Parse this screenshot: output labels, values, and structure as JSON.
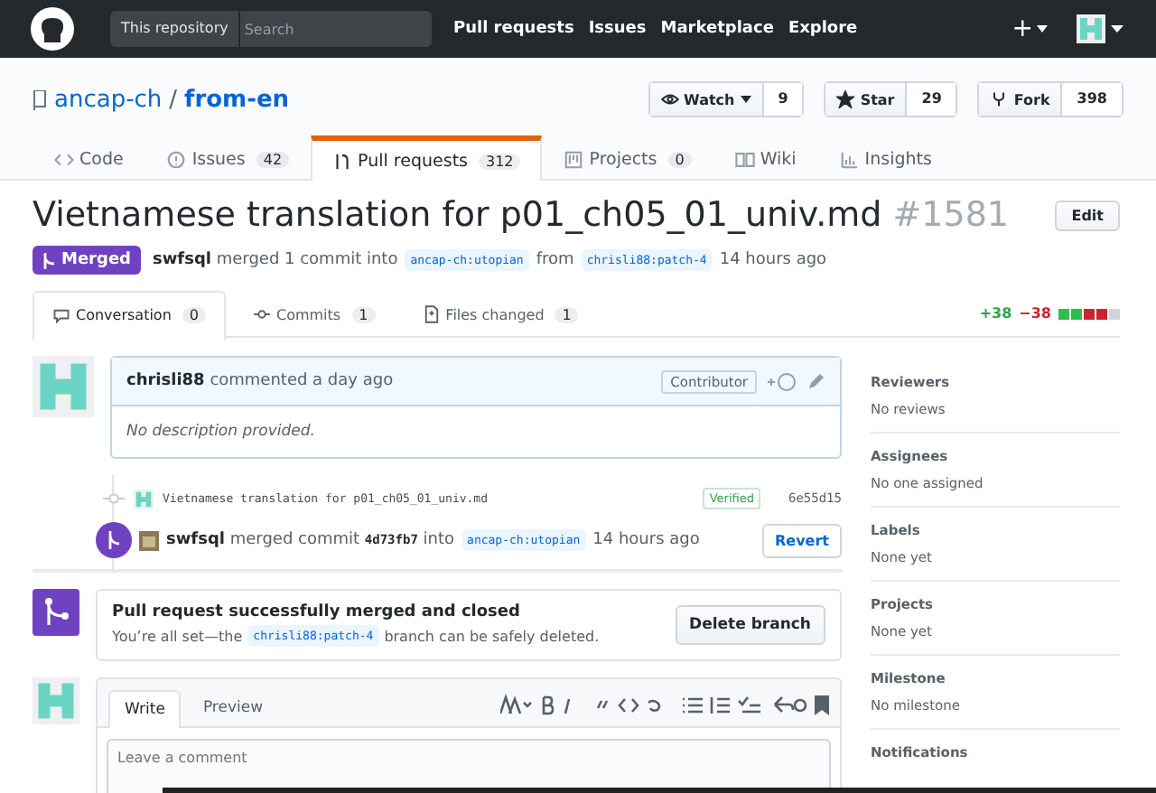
{
  "header": {
    "scope": "This repository",
    "search_placeholder": "Search",
    "nav": [
      "Pull requests",
      "Issues",
      "Marketplace",
      "Explore"
    ],
    "plus": "+"
  },
  "repo": {
    "owner": "ancap-ch",
    "separator": "/",
    "name": "from-en",
    "actions": [
      {
        "label": "Watch",
        "count": "9",
        "kind": "eye"
      },
      {
        "label": "Star",
        "count": "29",
        "kind": "star"
      },
      {
        "label": "Fork",
        "count": "398",
        "kind": "fork"
      }
    ]
  },
  "repo_tabs": [
    {
      "label": "Code",
      "kind": "code",
      "selected": false
    },
    {
      "label": "Issues",
      "count": "42",
      "kind": "issue",
      "selected": false
    },
    {
      "label": "Pull requests",
      "count": "312",
      "kind": "pr",
      "selected": true
    },
    {
      "label": "Projects",
      "count": "0",
      "kind": "project",
      "selected": false
    },
    {
      "label": "Wiki",
      "kind": "wiki",
      "selected": false
    },
    {
      "label": "Insights",
      "kind": "graph",
      "selected": false
    }
  ],
  "pr": {
    "title": "Vietnamese translation for p01_ch05_01_univ.md",
    "number": "#1581",
    "edit": "Edit",
    "state": "Merged",
    "author": "swfsql",
    "summary": "merged 1 commit into",
    "base": "ancap-ch:utopian",
    "from": "from",
    "head": "chrisli88:patch-4",
    "time": "14 hours ago"
  },
  "pr_tabs": [
    {
      "label": "Conversation",
      "count": "0",
      "kind": "comment",
      "selected": true
    },
    {
      "label": "Commits",
      "count": "1",
      "kind": "commit",
      "selected": false
    },
    {
      "label": "Files changed",
      "count": "1",
      "kind": "file",
      "selected": false
    }
  ],
  "diffstat": {
    "added": "+38",
    "removed": "−38",
    "blocks": [
      {
        "kind": "add"
      },
      {
        "kind": "add"
      },
      {
        "kind": "del"
      },
      {
        "kind": "del"
      },
      {
        "kind": "neutral"
      }
    ]
  },
  "comment": {
    "author": "chrisli88",
    "action": "commented a day ago",
    "badge": "Contributor",
    "body": "No description provided."
  },
  "commit": {
    "message": "Vietnamese translation for p01_ch05_01_univ.md",
    "verified": "Verified",
    "sha": "6e55d15"
  },
  "merge_event": {
    "author": "swfsql",
    "action": "merged commit",
    "sha": "4d73fb7",
    "into": "into",
    "base": "ancap-ch:utopian",
    "time": "14 hours ago",
    "revert": "Revert"
  },
  "merged_box": {
    "title": "Pull request successfully merged and closed",
    "pre": "You’re all set—the",
    "branch": "chrisli88:patch-4",
    "post": "branch can be safely deleted.",
    "button": "Delete branch"
  },
  "editor": {
    "tabs": [
      {
        "label": "Write",
        "selected": true
      },
      {
        "label": "Preview",
        "selected": false
      }
    ],
    "placeholder": "Leave a comment"
  },
  "sidebar": [
    {
      "heading": "Reviewers",
      "value": "No reviews"
    },
    {
      "heading": "Assignees",
      "value": "No one assigned"
    },
    {
      "heading": "Labels",
      "value": "None yet"
    },
    {
      "heading": "Projects",
      "value": "None yet"
    },
    {
      "heading": "Milestone",
      "value": "No milestone"
    },
    {
      "heading": "Notifications"
    }
  ]
}
